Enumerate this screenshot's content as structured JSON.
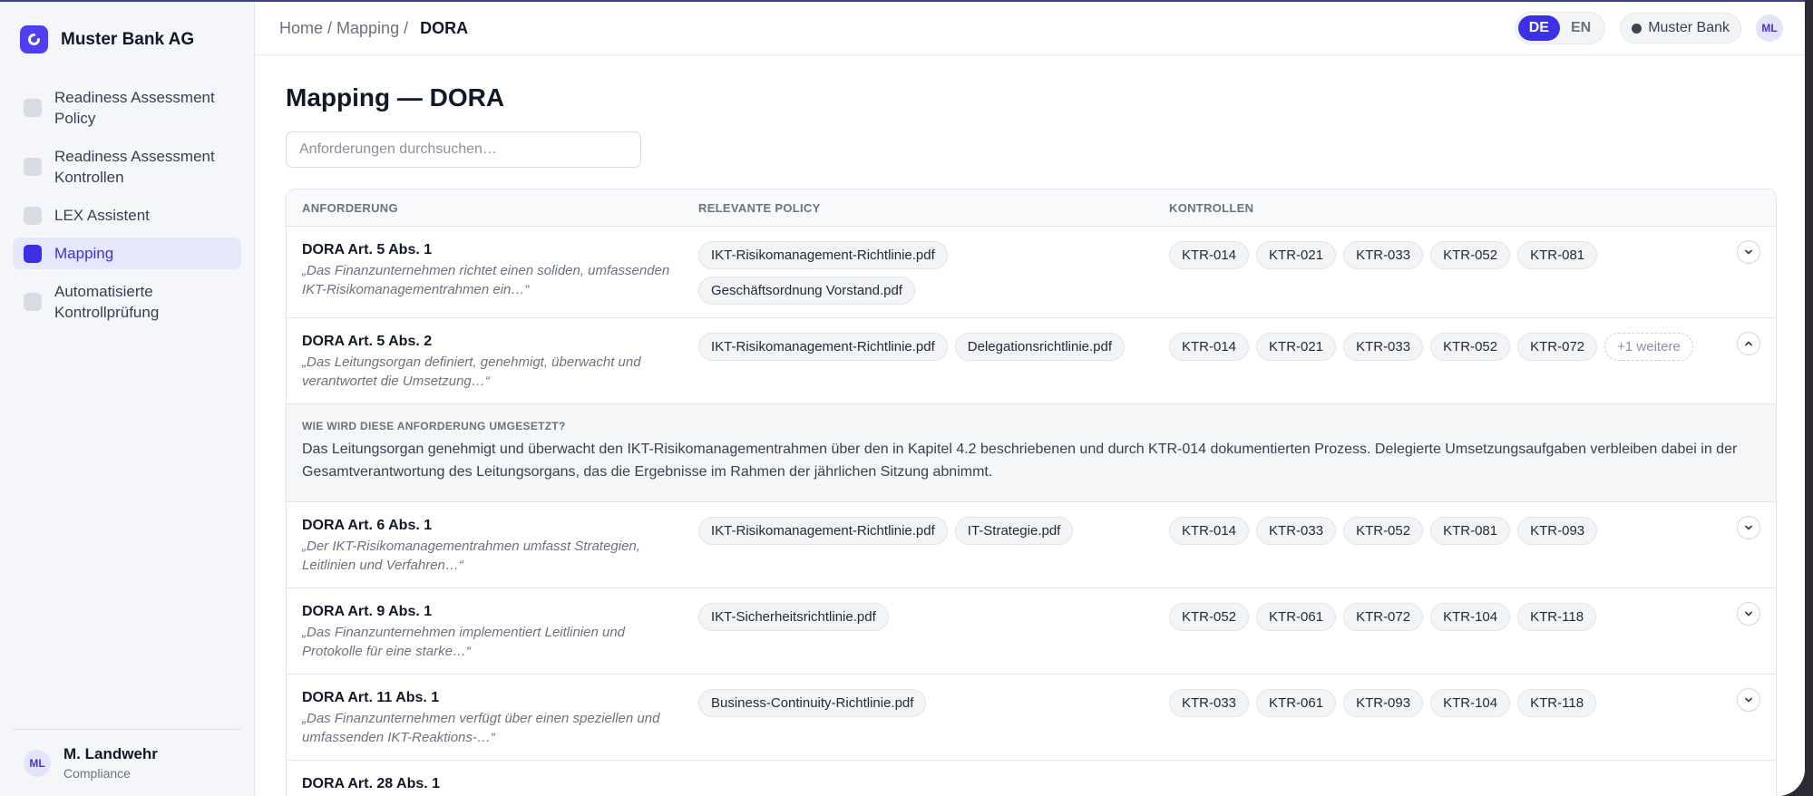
{
  "brand": {
    "name": "Muster Bank AG"
  },
  "nav": [
    {
      "label": "Readiness Assessment Policy",
      "active": false
    },
    {
      "label": "Readiness Assessment Kontrollen",
      "active": false
    },
    {
      "label": "LEX Assistent",
      "active": false
    },
    {
      "label": "Mapping",
      "active": true
    },
    {
      "label": "Automatisierte Kontrollprüfung",
      "active": false
    }
  ],
  "user": {
    "initials": "ML",
    "name": "M. Landwehr",
    "role": "Compliance"
  },
  "breadcrumb": {
    "home": "Home",
    "sep": "/",
    "mapping": "Mapping",
    "current": "DORA"
  },
  "lang": {
    "de": "DE",
    "en": "EN"
  },
  "bank_chip": "Muster Bank",
  "page_title": "Mapping — DORA",
  "search": {
    "placeholder": "Anforderungen durchsuchen…"
  },
  "table": {
    "headers": {
      "requirement": "ANFORDERUNG",
      "policy": "RELEVANTE POLICY",
      "controls": "KONTROLLEN"
    },
    "rows": [
      {
        "title": "DORA Art. 5 Abs. 1",
        "quote": "„Das Finanzunternehmen richtet einen soliden, umfassenden IKT-Risikomanagementrahmen ein…“",
        "policies": [
          "IKT-Risikomanagement-Richtlinie.pdf",
          "Geschäftsordnung Vorstand.pdf"
        ],
        "controls": [
          "KTR-014",
          "KTR-021",
          "KTR-033",
          "KTR-052",
          "KTR-081"
        ],
        "more": "",
        "expanded": false
      },
      {
        "title": "DORA Art. 5 Abs. 2",
        "quote": "„Das Leitungsorgan definiert, genehmigt, überwacht und verantwortet die Umsetzung…“",
        "policies": [
          "IKT-Risikomanagement-Richtlinie.pdf",
          "Delegationsrichtlinie.pdf"
        ],
        "controls": [
          "KTR-014",
          "KTR-021",
          "KTR-033",
          "KTR-052",
          "KTR-072"
        ],
        "more": "+1 weitere",
        "expanded": true
      },
      {
        "title": "DORA Art. 6 Abs. 1",
        "quote": "„Der IKT-Risikomanagementrahmen umfasst Strategien, Leitlinien und Verfahren…“",
        "policies": [
          "IKT-Risikomanagement-Richtlinie.pdf",
          "IT-Strategie.pdf"
        ],
        "controls": [
          "KTR-014",
          "KTR-033",
          "KTR-052",
          "KTR-081",
          "KTR-093"
        ],
        "more": "",
        "expanded": false
      },
      {
        "title": "DORA Art. 9 Abs. 1",
        "quote": "„Das Finanzunternehmen implementiert Leitlinien und Protokolle für eine starke…“",
        "policies": [
          "IKT-Sicherheitsrichtlinie.pdf"
        ],
        "controls": [
          "KTR-052",
          "KTR-061",
          "KTR-072",
          "KTR-104",
          "KTR-118"
        ],
        "more": "",
        "expanded": false
      },
      {
        "title": "DORA Art. 11 Abs. 1",
        "quote": "„Das Finanzunternehmen verfügt über einen speziellen und umfassenden IKT-Reaktions-…“",
        "policies": [
          "Business-Continuity-Richtlinie.pdf"
        ],
        "controls": [
          "KTR-033",
          "KTR-061",
          "KTR-093",
          "KTR-104",
          "KTR-118"
        ],
        "more": "",
        "expanded": false
      },
      {
        "title": "DORA Art. 28 Abs. 1",
        "quote": "",
        "policies": [
          ""
        ],
        "controls": [
          "",
          "",
          "",
          "",
          ""
        ],
        "more": "",
        "expanded": false
      }
    ],
    "detail": {
      "label": "WIE WIRD DIESE ANFORDERUNG UMGESETZT?",
      "text": "Das Leitungsorgan genehmigt und überwacht den IKT-Risikomanagementrahmen über den in Kapitel 4.2 beschriebenen und durch KTR-014 dokumentierten Prozess. Delegierte Umsetzungsaufgaben verbleiben dabei in der Gesamtverantwortung des Leitungsorgans, das die Ergebnisse im Rahmen der jährlichen Sitzung abnimmt."
    }
  },
  "colors": {
    "accent": "#3b30e6",
    "active_bg": "#e6e7fb"
  }
}
